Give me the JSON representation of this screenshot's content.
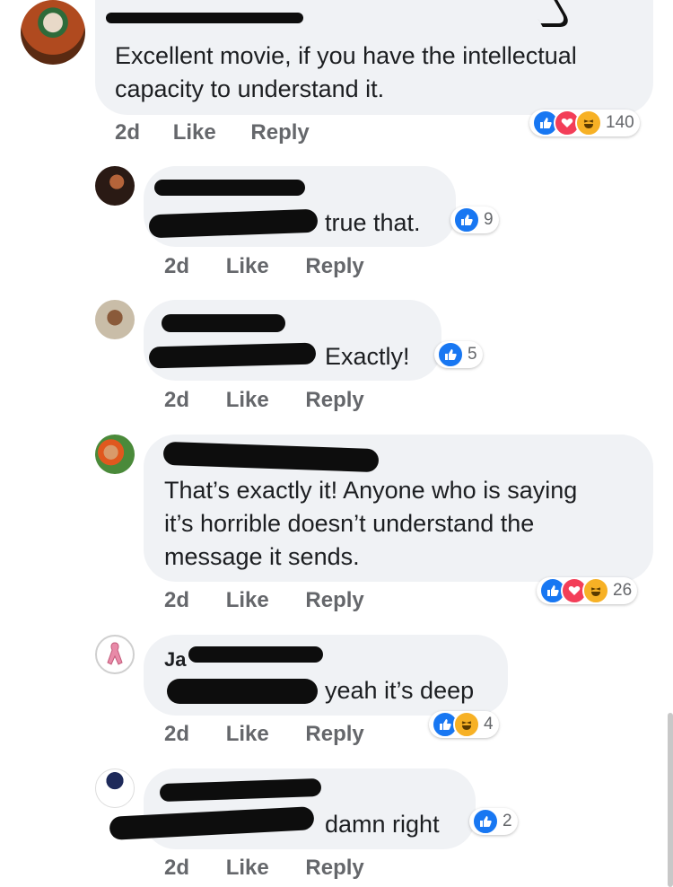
{
  "comments": [
    {
      "text_line1": "Excellent movie, if you have the intellectual",
      "text_line2": "capacity to understand it.",
      "time": "2d",
      "like": "Like",
      "reply": "Reply",
      "reaction_count": "140"
    },
    {
      "text": "true that.",
      "time": "2d",
      "like": "Like",
      "reply": "Reply",
      "reaction_count": "9"
    },
    {
      "text": "Exactly!",
      "time": "2d",
      "like": "Like",
      "reply": "Reply",
      "reaction_count": "5"
    },
    {
      "text_line1": "That’s exactly it! Anyone who is saying",
      "text_line2": "it’s horrible doesn’t understand the",
      "text_line3": "message it sends.",
      "time": "2d",
      "like": "Like",
      "reply": "Reply",
      "reaction_count": "26"
    },
    {
      "name_fragment": "Ja",
      "text": "yeah it’s deep",
      "time": "2d",
      "like": "Like",
      "reply": "Reply",
      "reaction_count": "4"
    },
    {
      "text": "damn right",
      "time": "2d",
      "like": "Like",
      "reply": "Reply",
      "reaction_count": "2"
    }
  ],
  "colors": {
    "bubble": "#f0f2f5",
    "like_blue": "#1877f2",
    "love_red": "#f33e58",
    "haha_yellow": "#f7b125",
    "meta_gray": "#65676b"
  },
  "icons": [
    "like-icon",
    "love-icon",
    "haha-icon"
  ]
}
